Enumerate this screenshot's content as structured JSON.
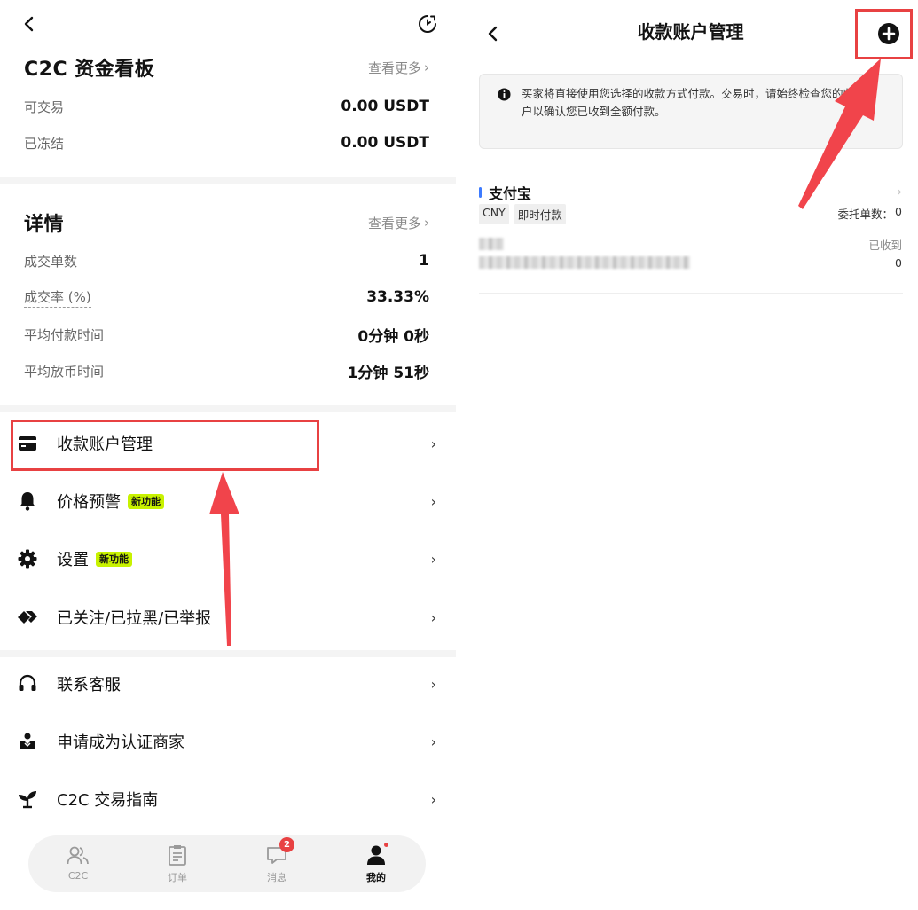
{
  "left": {
    "fund_board": {
      "title": "C2C 资金看板",
      "see_more": "查看更多",
      "rows": [
        {
          "label": "可交易",
          "value": "0.00 USDT"
        },
        {
          "label": "已冻结",
          "value": "0.00 USDT"
        }
      ]
    },
    "details": {
      "title": "详情",
      "see_more": "查看更多",
      "rows": [
        {
          "label": "成交单数",
          "value": "1"
        },
        {
          "label": "成交率 (%)",
          "value": "33.33%"
        },
        {
          "label": "平均付款时间",
          "value": "0分钟 0秒"
        },
        {
          "label": "平均放币时间",
          "value": "1分钟 51秒"
        }
      ]
    },
    "menu": [
      {
        "label": "收款账户管理",
        "icon": "card-icon"
      },
      {
        "label": "价格预警",
        "icon": "bell-icon",
        "badge": "新功能"
      },
      {
        "label": "设置",
        "icon": "gear-icon",
        "badge": "新功能"
      },
      {
        "label": "已关注/已拉黑/已举报",
        "icon": "tag-icon"
      },
      {
        "label": "联系客服",
        "icon": "headset-icon"
      },
      {
        "label": "申请成为认证商家",
        "icon": "merchant-icon"
      },
      {
        "label": "C2C 交易指南",
        "icon": "sprout-icon"
      }
    ],
    "nav": [
      {
        "label": "C2C",
        "icon": "users-icon"
      },
      {
        "label": "订单",
        "icon": "clipboard-icon"
      },
      {
        "label": "消息",
        "icon": "chat-icon",
        "count": "2"
      },
      {
        "label": "我的",
        "icon": "person-icon"
      }
    ]
  },
  "right": {
    "title": "收款账户管理",
    "info": "买家将直接使用您选择的收款方式付款。交易时，请始终检查您的收款账户以确认您已收到全额付款。",
    "account": {
      "name": "支付宝",
      "tags": [
        "CNY",
        "即时付款"
      ],
      "order_count_label": "委托单数：",
      "order_count": "0",
      "received_label": "已收到",
      "received_value": "0"
    }
  },
  "colors": {
    "accent_red": "#e84142",
    "badge_green": "#c8f200",
    "alipay_blue": "#3d7bff"
  }
}
